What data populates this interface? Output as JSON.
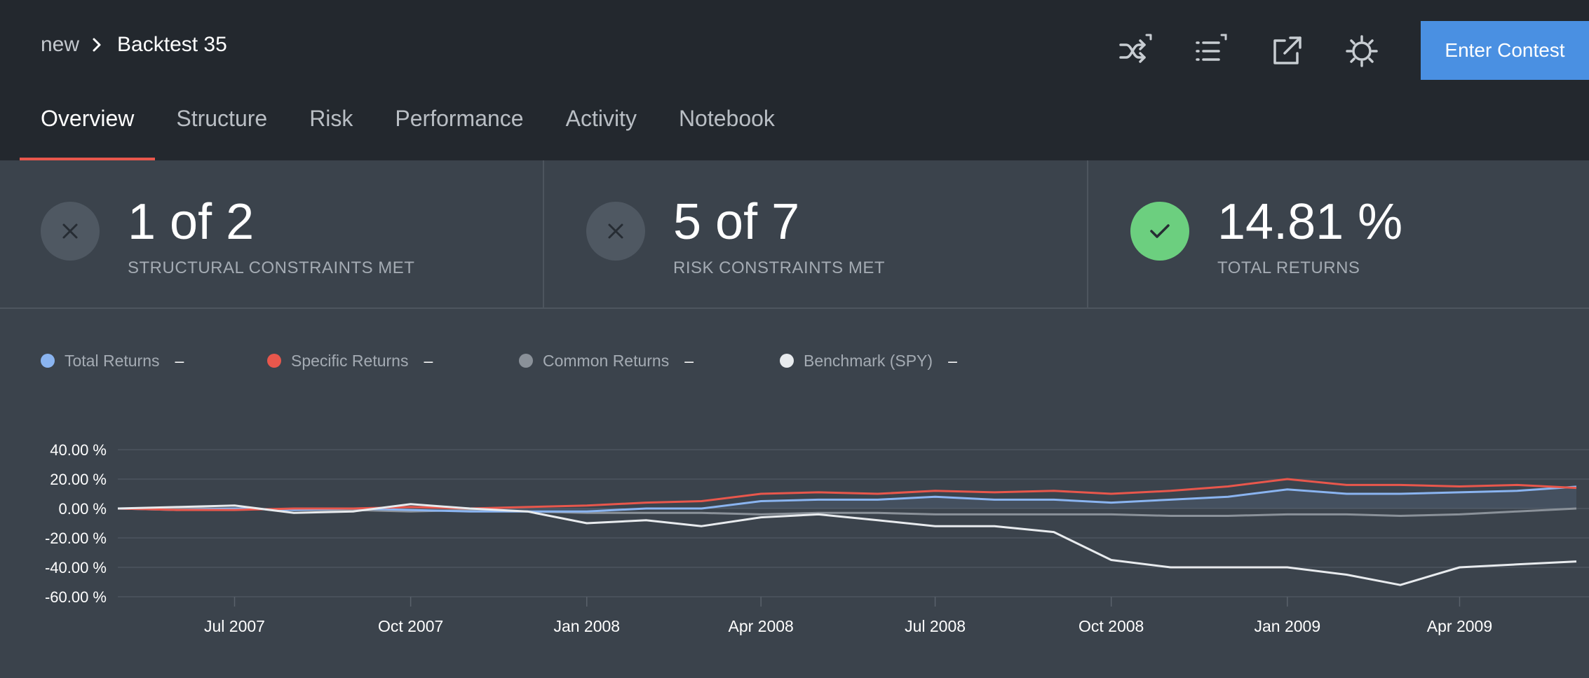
{
  "breadcrumb": {
    "parent": "new",
    "current": "Backtest 35"
  },
  "header": {
    "icons": [
      "shuffle-icon",
      "list-icon",
      "share-icon",
      "settings-icon"
    ],
    "enter_button": "Enter Contest"
  },
  "tabs": [
    {
      "label": "Overview",
      "active": true
    },
    {
      "label": "Structure",
      "active": false
    },
    {
      "label": "Risk",
      "active": false
    },
    {
      "label": "Performance",
      "active": false
    },
    {
      "label": "Activity",
      "active": false
    },
    {
      "label": "Notebook",
      "active": false
    }
  ],
  "stats": [
    {
      "value": "1 of 2",
      "label": "STRUCTURAL CONSTRAINTS MET",
      "status": "fail"
    },
    {
      "value": "5 of 7",
      "label": "RISK CONSTRAINTS MET",
      "status": "fail"
    },
    {
      "value": "14.81 %",
      "label": "TOTAL RETURNS",
      "status": "pass"
    }
  ],
  "colors": {
    "accent": "#4a90e2",
    "tab_underline": "#e8574c",
    "pass": "#6ccf7f"
  },
  "legend": [
    {
      "name": "Total Returns",
      "value": "–",
      "color": "#8ab4f0"
    },
    {
      "name": "Specific Returns",
      "value": "–",
      "color": "#e8574c"
    },
    {
      "name": "Common Returns",
      "value": "–",
      "color": "#8a9199"
    },
    {
      "name": "Benchmark (SPY)",
      "value": "–",
      "color": "#e8ebee"
    }
  ],
  "chart_data": {
    "type": "line",
    "title": "",
    "xlabel": "",
    "ylabel": "",
    "ylim": [
      -60,
      40
    ],
    "y_ticks": [
      "40.00 %",
      "20.00 %",
      "0.00 %",
      "-20.00 %",
      "-40.00 %",
      "-60.00 %"
    ],
    "x_ticks": [
      "Jul 2007",
      "Oct 2007",
      "Jan 2008",
      "Apr 2008",
      "Jul 2008",
      "Oct 2008",
      "Jan 2009",
      "Apr 2009"
    ],
    "x": [
      "2007-05-01",
      "2007-06-01",
      "2007-07-01",
      "2007-08-01",
      "2007-09-01",
      "2007-10-01",
      "2007-11-01",
      "2007-12-01",
      "2008-01-01",
      "2008-02-01",
      "2008-03-01",
      "2008-04-01",
      "2008-05-01",
      "2008-06-01",
      "2008-07-01",
      "2008-08-01",
      "2008-09-01",
      "2008-10-01",
      "2008-11-01",
      "2008-12-01",
      "2009-01-01",
      "2009-02-01",
      "2009-03-01",
      "2009-04-01",
      "2009-05-01",
      "2009-06-01"
    ],
    "series": [
      {
        "name": "Total Returns",
        "color": "#8ab4f0",
        "fill": true,
        "values": [
          0,
          -1,
          0,
          -1,
          0,
          -1,
          -2,
          -2,
          -2,
          0,
          0,
          5,
          6,
          6,
          8,
          6,
          6,
          4,
          6,
          8,
          13,
          10,
          10,
          11,
          12,
          14.81
        ]
      },
      {
        "name": "Specific Returns",
        "color": "#e8574c",
        "values": [
          0,
          -1,
          -1,
          0,
          0,
          1,
          0,
          1,
          2,
          4,
          5,
          10,
          11,
          10,
          12,
          11,
          12,
          10,
          12,
          15,
          20,
          16,
          16,
          15,
          16,
          14
        ]
      },
      {
        "name": "Common Returns",
        "color": "#8a9199",
        "values": [
          0,
          0,
          0,
          -1,
          -1,
          -2,
          -1,
          -2,
          -3,
          -3,
          -3,
          -4,
          -3,
          -3,
          -4,
          -4,
          -4,
          -4,
          -5,
          -5,
          -4,
          -4,
          -5,
          -4,
          -2,
          0
        ]
      },
      {
        "name": "Benchmark (SPY)",
        "color": "#e8ebee",
        "values": [
          0,
          1,
          2,
          -3,
          -2,
          3,
          0,
          -2,
          -10,
          -8,
          -12,
          -6,
          -4,
          -8,
          -12,
          -12,
          -16,
          -35,
          -40,
          -40,
          -40,
          -45,
          -52,
          -40,
          -38,
          -36
        ]
      }
    ]
  }
}
